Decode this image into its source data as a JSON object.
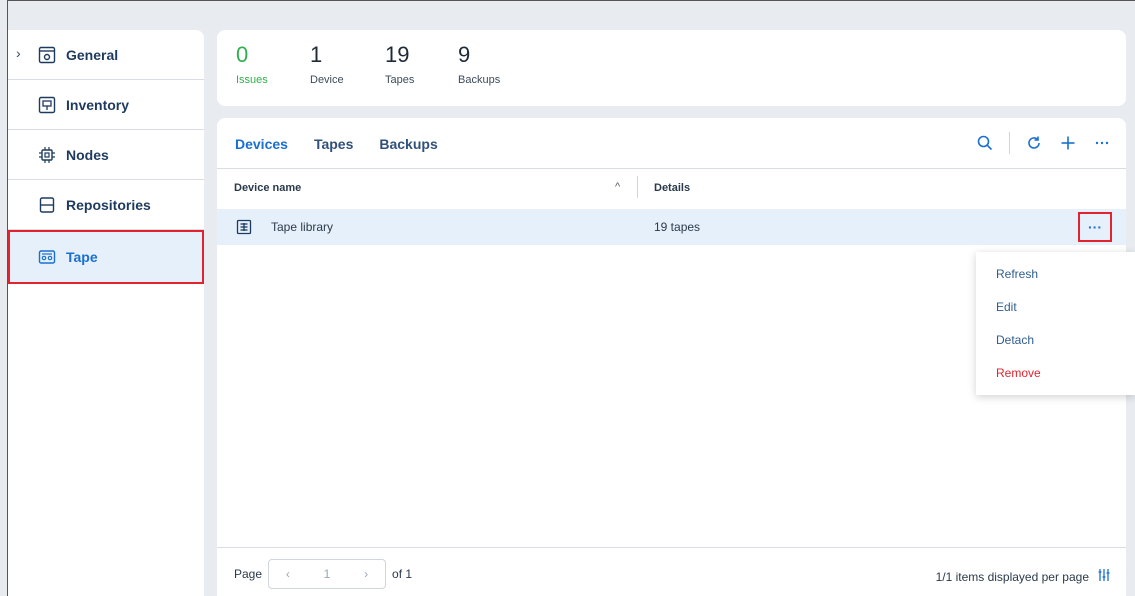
{
  "sidebar": {
    "items": [
      {
        "label": "General",
        "icon": "gear-box-icon"
      },
      {
        "label": "Inventory",
        "icon": "inventory-icon"
      },
      {
        "label": "Nodes",
        "icon": "chip-icon"
      },
      {
        "label": "Repositories",
        "icon": "repository-icon"
      },
      {
        "label": "Tape",
        "icon": "tape-icon",
        "active": true
      }
    ]
  },
  "stats": [
    {
      "value": "0",
      "label": "Issues"
    },
    {
      "value": "1",
      "label": "Device"
    },
    {
      "value": "19",
      "label": "Tapes"
    },
    {
      "value": "9",
      "label": "Backups"
    }
  ],
  "tabs": [
    "Devices",
    "Tapes",
    "Backups"
  ],
  "toolbar": [
    "search-icon",
    "refresh-icon",
    "add-icon",
    "more-icon"
  ],
  "table": {
    "headers": {
      "name": "Device name",
      "details": "Details"
    },
    "rows": [
      {
        "name": "Tape library",
        "details": "19 tapes"
      }
    ]
  },
  "context_menu": {
    "items": [
      "Refresh",
      "Edit",
      "Detach",
      "Remove"
    ]
  },
  "pager": {
    "page_label": "Page",
    "current": "1",
    "of_label": "of 1",
    "per_page": "1/1 items displayed per page"
  },
  "colors": {
    "accent": "#1a6fd0",
    "issues": "#2eb24c",
    "danger": "#e0232e",
    "selected_bg": "#e6f0fb"
  }
}
